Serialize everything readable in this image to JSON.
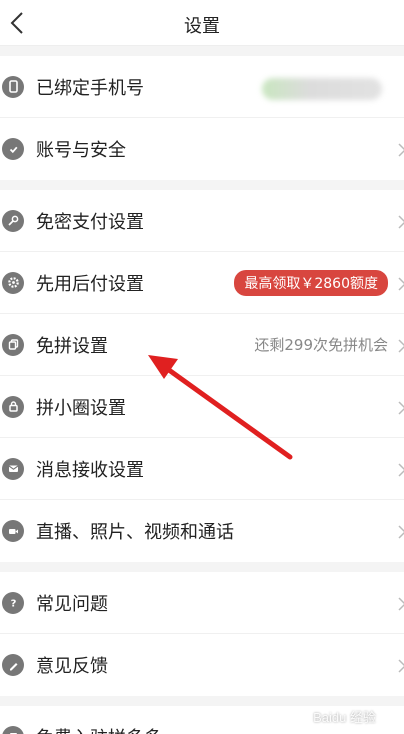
{
  "header": {
    "title": "设置"
  },
  "groups": [
    {
      "items": [
        {
          "label": "已绑定手机号",
          "icon": "phone-icon"
        },
        {
          "label": "账号与安全",
          "icon": "shield-icon"
        }
      ]
    },
    {
      "items": [
        {
          "label": "免密支付设置",
          "icon": "key-icon"
        },
        {
          "label": "先用后付设置",
          "icon": "gear-icon",
          "badge": "最高领取￥2860额度"
        },
        {
          "label": "免拼设置",
          "icon": "copy-icon",
          "hint": "还剩299次免拼机会"
        },
        {
          "label": "拼小圈设置",
          "icon": "lock-icon"
        },
        {
          "label": "消息接收设置",
          "icon": "mail-icon"
        },
        {
          "label": "直播、照片、视频和通话",
          "icon": "video-icon"
        }
      ]
    },
    {
      "items": [
        {
          "label": "常见问题",
          "icon": "question-icon"
        },
        {
          "label": "意见反馈",
          "icon": "pen-icon"
        }
      ]
    },
    {
      "items": [
        {
          "label": "免费入驻拼多多",
          "icon": "store-icon"
        }
      ]
    }
  ],
  "watermark": "Baidu 经验",
  "colors": {
    "badge": "#d8463f",
    "arrow": "#e02020"
  }
}
